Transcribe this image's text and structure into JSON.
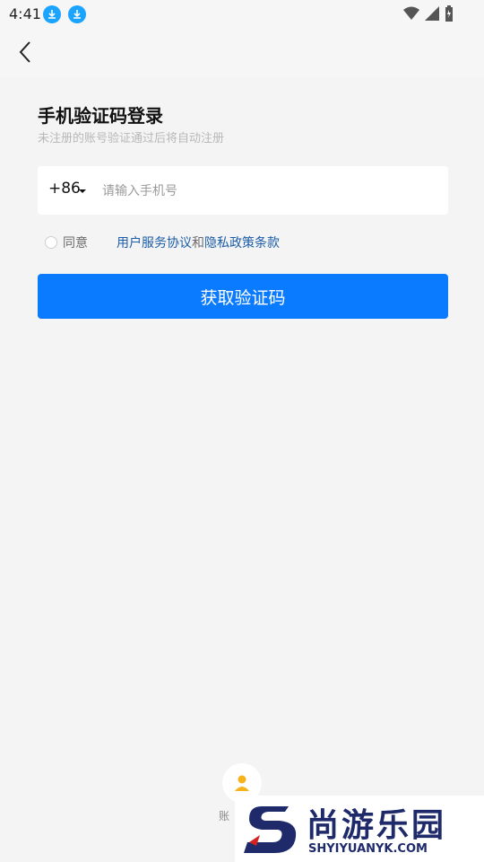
{
  "status": {
    "time": "4:41"
  },
  "header": {
    "back_icon": "back-arrow-icon"
  },
  "login": {
    "title": "手机验证码登录",
    "subtitle": "未注册的账号验证通过后将自动注册",
    "country_code": "+86",
    "phone_placeholder": "请输入手机号",
    "phone_value": "",
    "agree_label": "同意",
    "terms_link": "用户服务协议",
    "and_text": "和",
    "privacy_link": "隐私政策条款",
    "cta_label": "获取验证码",
    "agree_checked": false
  },
  "alt": {
    "label": "账"
  },
  "watermark": {
    "cn": "尚游乐园",
    "en": "SHYIYUANYK.COM"
  },
  "colors": {
    "primary": "#0a7bff",
    "link": "#1b5da8",
    "background": "#f4f4f4"
  }
}
